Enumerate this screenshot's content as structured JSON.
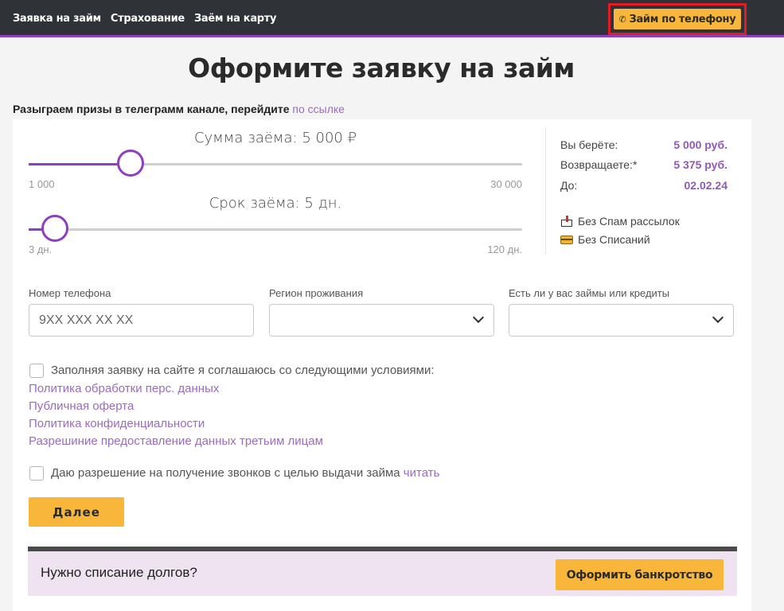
{
  "nav": {
    "items": [
      "Заявка на займ",
      "Страхование",
      "Заём на карту"
    ],
    "phone_button": "Займ по телефону",
    "phone_icon": "phone-icon"
  },
  "page": {
    "title": "Оформите заявку на займ"
  },
  "promo": {
    "text": "Разыграем призы в  телеграмм канале, перейдите ",
    "link": "по ссылке"
  },
  "amount_slider": {
    "label": "Сумма заёма: 5 000 ₽",
    "min_label": "1 000",
    "max_label": "30 000",
    "min": 1000,
    "max": 30000,
    "value": 5000
  },
  "term_slider": {
    "label": "Срок заёма: 5 дн.",
    "min_label": "3 дн.",
    "max_label": "120 дн.",
    "min": 3,
    "max": 120,
    "value": 5
  },
  "summary": {
    "take_label": "Вы берёте:",
    "take_value": "5 000 руб.",
    "return_label": "Возвращаете:*",
    "return_value": "5 375 руб.",
    "until_label": "До:",
    "until_value": "02.02.24"
  },
  "features": {
    "no_spam": "Без Спам рассылок",
    "no_charges": "Без Списаний"
  },
  "form": {
    "phone_label": "Номер телефона",
    "phone_placeholder": "9XX XXX XX XX",
    "region_label": "Регион проживания",
    "loans_label": "Есть ли у вас займы или кредиты"
  },
  "consent": {
    "text": "Заполняя заявку на сайте я соглашаюсь со следующими условиями:",
    "links": [
      "Политика обработки перс. данных",
      "Публичная оферта",
      "Политика конфиденциальности",
      "Разрешиние предоставление данных третьим лицам"
    ],
    "calls_text": "Даю разрешение на получение звонков с целью выдачи займа ",
    "calls_link": "читать"
  },
  "buttons": {
    "next": "Далее"
  },
  "debt": {
    "text": "Нужно списание долгов?",
    "button": "Оформить банкротство"
  },
  "colors": {
    "accent": "#8e3fbf",
    "button": "#f8b63a",
    "topbar": "#2f3337",
    "link": "#9b6bbf"
  }
}
